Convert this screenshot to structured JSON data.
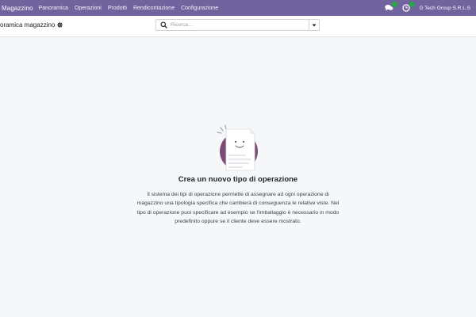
{
  "navbar": {
    "app_name": "Magazzino",
    "menu": [
      "Panoramica",
      "Operazioni",
      "Prodotti",
      "Rendicontazione",
      "Configurazione"
    ],
    "messages_badge": "",
    "activities_badge": "",
    "company": "G Tech Group S.R.L.S",
    "color": "#71639e",
    "badge_color": "#28a745"
  },
  "control_panel": {
    "breadcrumb": "oramica magazzino",
    "search_placeholder": "Ricerca..."
  },
  "empty_state": {
    "title": "Crea un nuovo tipo di operazione",
    "description": "Il sistema dei tipi di operazione permette di assegnare ad ogni operazione di magazzino una tipologia specifica che cambierà di conseguenza le relative viste. Nel tipo di operazione puoi specificare ad esempio se l'imballaggio è necessario in modo predefinito oppure se il cliente deve essere mostrato."
  },
  "icons": {
    "messages": "chat-bubbles-icon",
    "activities": "clock-icon",
    "gear": "gear-icon",
    "search": "search-icon",
    "toggle": "caret-down-icon"
  }
}
